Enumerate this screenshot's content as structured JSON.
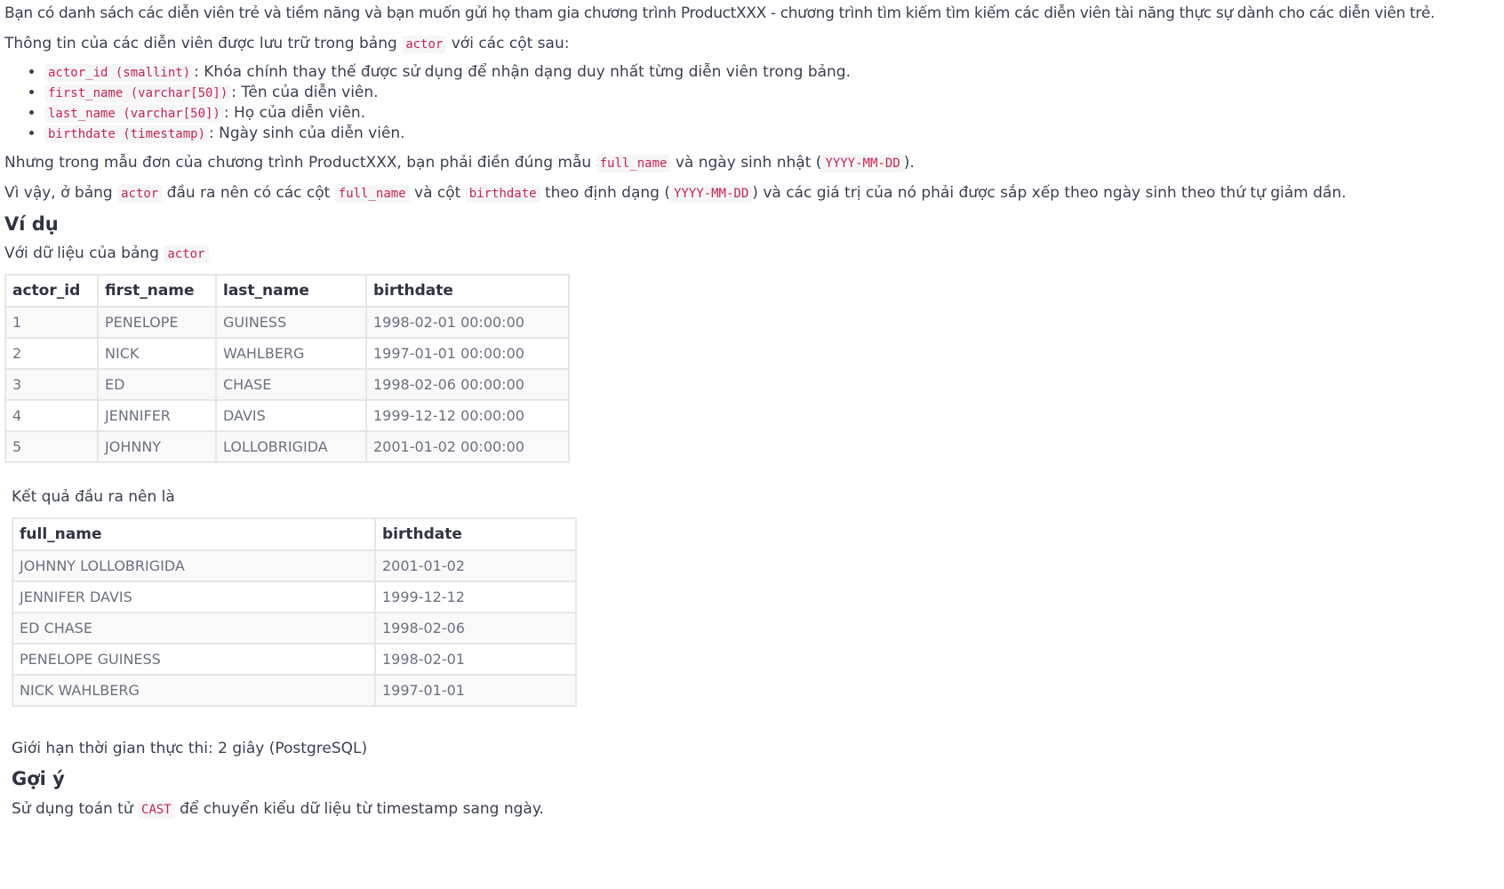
{
  "intro": {
    "p1": "Bạn có danh sách các diễn viên trẻ và tiềm năng và bạn muốn gửi họ tham gia chương trình ProductXXX - chương trình tìm kiếm tìm kiếm các diễn viên tài năng thực sự dành cho các diễn viên trẻ.",
    "p2_pre": "Thông tin của các diễn viên được lưu trữ trong bảng",
    "p2_code": "actor",
    "p2_post": "với các cột sau:"
  },
  "columns": [
    {
      "code": "actor_id (smallint)",
      "desc": ": Khóa chính thay thế được sử dụng để nhận dạng duy nhất từng diễn viên trong bảng."
    },
    {
      "code": "first_name (varchar[50])",
      "desc": ": Tên của diễn viên."
    },
    {
      "code": "last_name (varchar[50])",
      "desc": ": Họ của diễn viên."
    },
    {
      "code": "birthdate (timestamp)",
      "desc": ": Ngày sinh của diễn viên."
    }
  ],
  "para3": {
    "pre": "Nhưng trong mẫu đơn của chương trình ProductXXX, bạn phải điền đúng mẫu",
    "code1": "full_name",
    "mid": "và ngày sinh nhật (",
    "code2": "YYYY-MM-DD",
    "post": ")."
  },
  "para4": {
    "t1": "Vì vậy, ở bảng",
    "c1": "actor",
    "t2": "đầu ra nên có các cột",
    "c2": "full_name",
    "t3": "và cột",
    "c3": "birthdate",
    "t4": "theo định dạng (",
    "c4": "YYYY-MM-DD",
    "t5": ") và các giá trị của nó phải được sắp xếp theo ngày sinh theo thứ tự giảm dần."
  },
  "example_heading": "Ví dụ",
  "example_intro": {
    "pre": "Với dữ liệu của bảng",
    "code": "actor"
  },
  "actor_table": {
    "headers": [
      "actor_id",
      "first_name",
      "last_name",
      "birthdate"
    ],
    "rows": [
      [
        "1",
        "PENELOPE",
        "GUINESS",
        "1998-02-01 00:00:00"
      ],
      [
        "2",
        "NICK",
        "WAHLBERG",
        "1997-01-01 00:00:00"
      ],
      [
        "3",
        "ED",
        "CHASE",
        "1998-02-06 00:00:00"
      ],
      [
        "4",
        "JENNIFER",
        "DAVIS",
        "1999-12-12 00:00:00"
      ],
      [
        "5",
        "JOHNNY",
        "LOLLOBRIGIDA",
        "2001-01-02 00:00:00"
      ]
    ]
  },
  "result_intro": "Kết quả đầu ra nên là",
  "result_table": {
    "headers": [
      "full_name",
      "birthdate"
    ],
    "rows": [
      [
        "JOHNNY LOLLOBRIGIDA",
        "2001-01-02"
      ],
      [
        "JENNIFER DAVIS",
        "1999-12-12"
      ],
      [
        "ED CHASE",
        "1998-02-06"
      ],
      [
        "PENELOPE GUINESS",
        "1998-02-01"
      ],
      [
        "NICK WAHLBERG",
        "1997-01-01"
      ]
    ]
  },
  "time_limit": "Giới hạn thời gian thực thi: 2 giây (PostgreSQL)",
  "hint_heading": "Gợi ý",
  "hint": {
    "pre": "Sử dụng toán tử",
    "code": "CAST",
    "post": "để chuyển kiểu dữ liệu từ timestamp sang ngày."
  }
}
